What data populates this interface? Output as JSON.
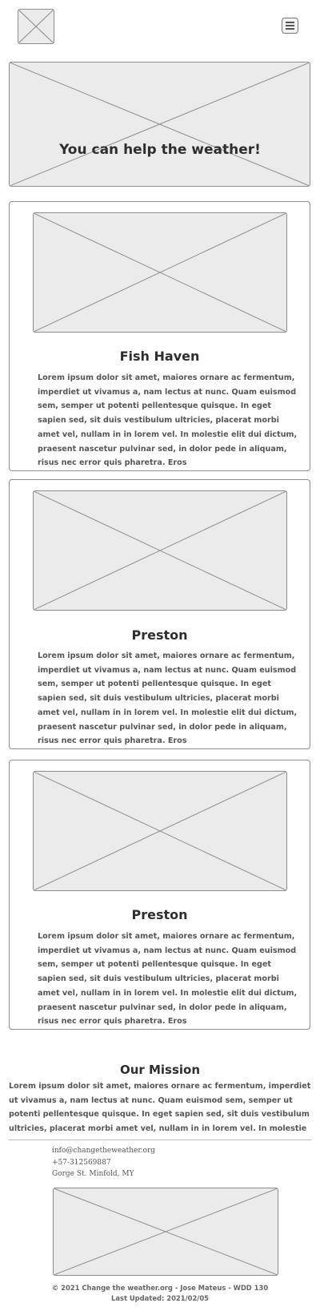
{
  "header": {
    "logo_icon": "image-placeholder-icon",
    "menu_icon": "hamburger-menu-icon"
  },
  "hero": {
    "title": "You can help the weather!"
  },
  "cards": [
    {
      "title": "Fish Haven",
      "text": "Lorem ipsum dolor sit amet, maiores ornare ac fermentum, imperdiet ut vivamus a, nam lectus at nunc. Quam euismod sem, semper ut potenti pellentesque quisque. In eget sapien sed, sit duis vestibulum ultricies, placerat morbi amet vel, nullam in in lorem vel. In molestie elit dui dictum, praesent nascetur pulvinar sed, in dolor pede in aliquam, risus nec error quis pharetra. Eros"
    },
    {
      "title": "Preston",
      "text": "Lorem ipsum dolor sit amet, maiores ornare ac fermentum, imperdiet ut vivamus a, nam lectus at nunc. Quam euismod sem, semper ut potenti pellentesque quisque. In eget sapien sed, sit duis vestibulum ultricies, placerat morbi amet vel, nullam in in lorem vel. In molestie elit dui dictum, praesent nascetur pulvinar sed, in dolor pede in aliquam, risus nec error quis pharetra. Eros"
    },
    {
      "title": "Preston",
      "text": "Lorem ipsum dolor sit amet, maiores ornare ac fermentum, imperdiet ut vivamus a, nam lectus at nunc. Quam euismod sem, semper ut potenti pellentesque quisque. In eget sapien sed, sit duis vestibulum ultricies, placerat morbi amet vel, nullam in in lorem vel. In molestie elit dui dictum, praesent nascetur pulvinar sed, in dolor pede in aliquam, risus nec error quis pharetra. Eros"
    }
  ],
  "mission": {
    "title": "Our Mission",
    "text": "Lorem ipsum dolor sit amet, maiores ornare ac fermentum, imperdiet ut vivamus a, nam lectus at nunc. Quam euismod sem, semper ut potenti pellentesque quisque. In eget sapien sed, sit duis vestibulum ultricies, placerat morbi amet vel, nullam in in lorem vel. In molestie elit dui dictum, praesent"
  },
  "contact": {
    "email": "info@changetheweather.org",
    "phone": "+57-312569887",
    "address": "Gorge St. Minfold, MY"
  },
  "footer": {
    "copyright": "© 2021 Change the weather.org - Jose Mateus - WDD 130",
    "updated": "Last Updated: 2021/02/05"
  },
  "colors": {
    "placeholder_fill": "#ebebeb",
    "placeholder_stroke": "#8c8c8c",
    "heading": "#2e2e2e",
    "body_text": "#555555"
  }
}
